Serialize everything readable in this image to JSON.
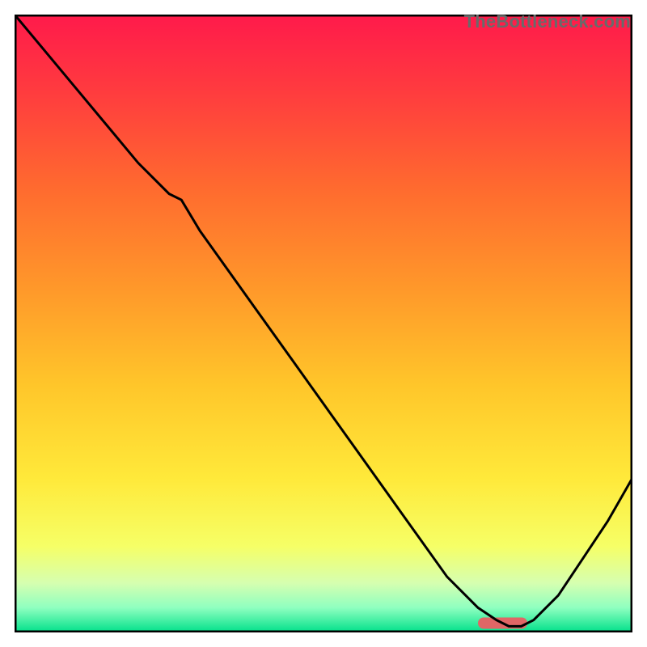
{
  "watermark": "TheBottleneck.com",
  "chart_data": {
    "type": "line",
    "title": "",
    "xlabel": "",
    "ylabel": "",
    "xlim": [
      0,
      100
    ],
    "ylim": [
      0,
      100
    ],
    "grid": false,
    "legend": false,
    "series": [
      {
        "name": "bottleneck-curve",
        "color": "#000000",
        "x": [
          0,
          5,
          10,
          15,
          20,
          25,
          27,
          30,
          35,
          40,
          45,
          50,
          55,
          60,
          65,
          70,
          75,
          78,
          80,
          82,
          84,
          88,
          92,
          96,
          100
        ],
        "y": [
          100,
          94,
          88,
          82,
          76,
          71,
          70,
          65,
          58,
          51,
          44,
          37,
          30,
          23,
          16,
          9,
          4,
          2,
          1,
          1,
          2,
          6,
          12,
          18,
          25
        ]
      }
    ],
    "optimal_marker": {
      "x_center": 79,
      "x_half_width": 4,
      "y": 1.5,
      "color": "#e06666"
    },
    "background": {
      "type": "vertical-gradient",
      "stops": [
        {
          "pct": 0,
          "color": "#ff1a4b"
        },
        {
          "pct": 12,
          "color": "#ff3a3f"
        },
        {
          "pct": 28,
          "color": "#ff6a2f"
        },
        {
          "pct": 45,
          "color": "#ff9a2a"
        },
        {
          "pct": 60,
          "color": "#ffc62a"
        },
        {
          "pct": 75,
          "color": "#ffe93a"
        },
        {
          "pct": 86,
          "color": "#f6ff66"
        },
        {
          "pct": 92,
          "color": "#d6ffb0"
        },
        {
          "pct": 96,
          "color": "#8fffc0"
        },
        {
          "pct": 100,
          "color": "#00e08a"
        }
      ]
    }
  }
}
